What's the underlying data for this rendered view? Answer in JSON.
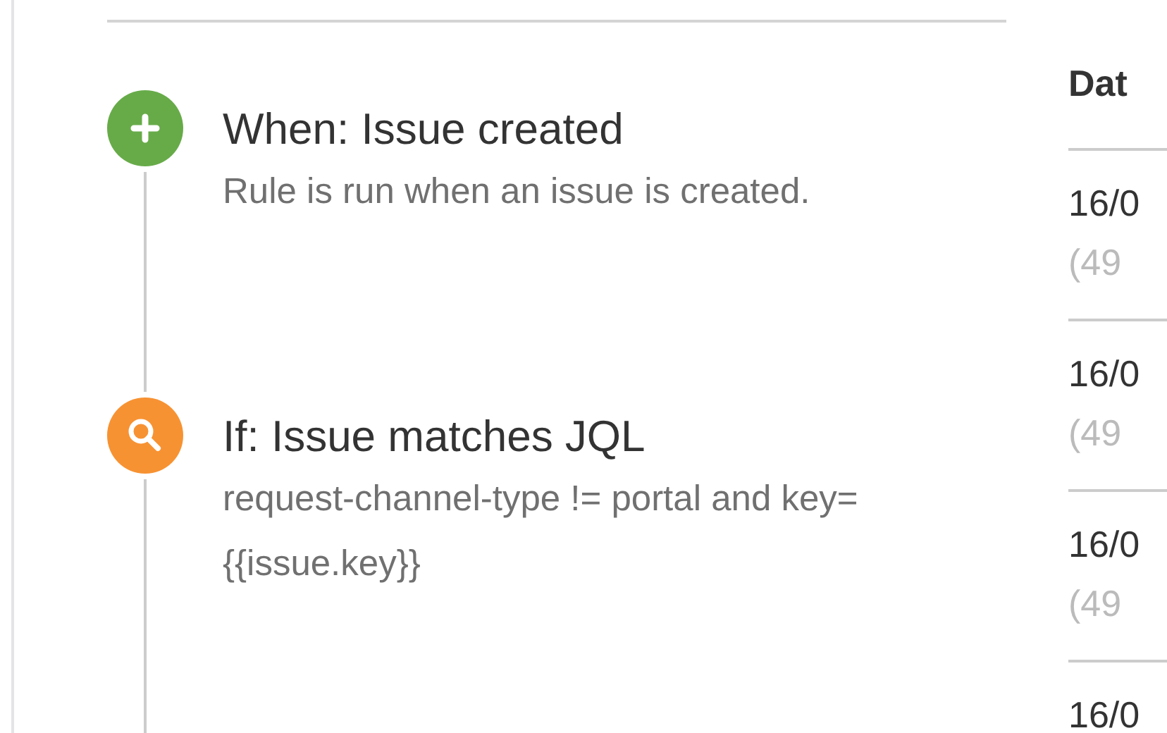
{
  "steps": [
    {
      "kind": "trigger",
      "title": "When: Issue created",
      "description": "Rule is run when an issue is created."
    },
    {
      "kind": "condition",
      "title": "If: Issue matches JQL",
      "description": "request-channel-type != portal and key= {{issue.key}}"
    }
  ],
  "table": {
    "column_1": "Dat",
    "rows": [
      {
        "date": "16/0",
        "detail": "(49"
      },
      {
        "date": "16/0",
        "detail": "(49"
      },
      {
        "date": "16/0",
        "detail": "(49"
      },
      {
        "date": "16/0"
      }
    ]
  }
}
